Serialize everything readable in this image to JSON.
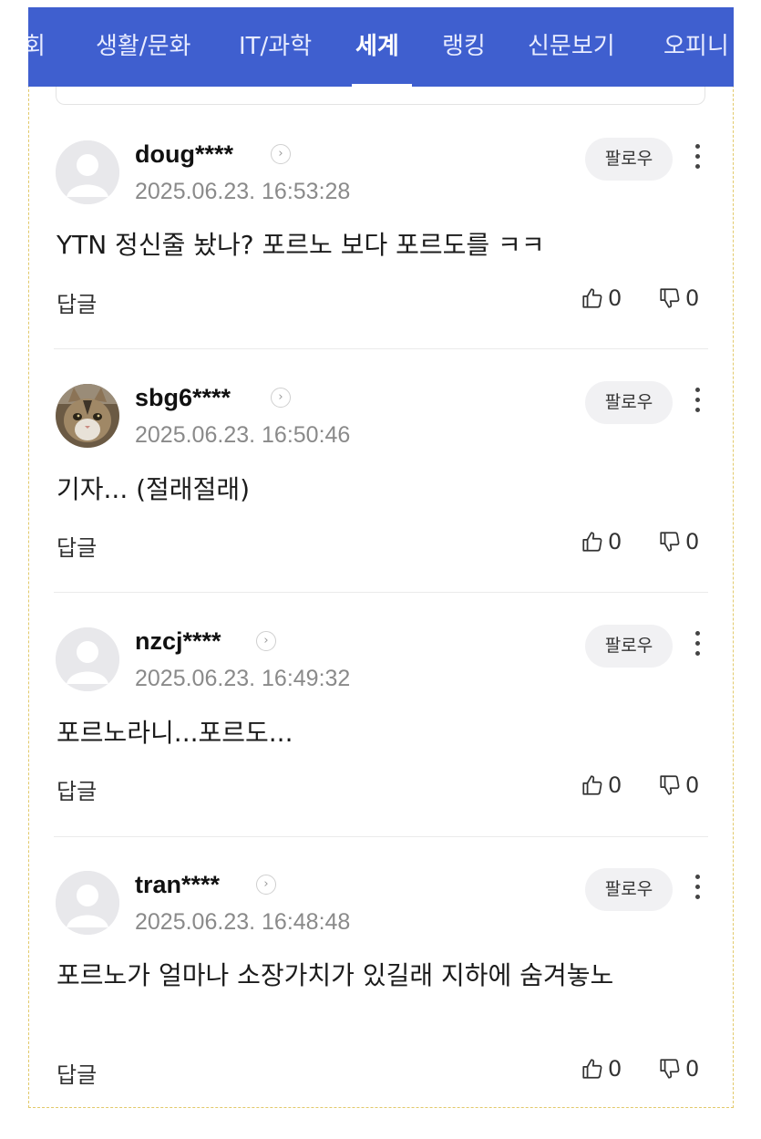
{
  "nav": {
    "items": [
      {
        "label": "회"
      },
      {
        "label": "생활/문화"
      },
      {
        "label": "IT/과학"
      },
      {
        "label": "세계"
      },
      {
        "label": "랭킹"
      },
      {
        "label": "신문보기"
      },
      {
        "label": "오피니"
      }
    ],
    "active_index": 3,
    "bg_color": "#3f5fcf"
  },
  "comments": [
    {
      "username": "doug****",
      "timestamp": "2025.06.23. 16:53:28",
      "text": "YTN 정신줄 놨나? 포르노 보다 포르도를 ㅋㅋ",
      "follow_label": "팔로우",
      "reply_label": "답글",
      "likes": "0",
      "dislikes": "0",
      "avatar": "default-avatar-icon"
    },
    {
      "username": "sbg6****",
      "timestamp": "2025.06.23. 16:50:46",
      "text": "기자... (절래절래)",
      "follow_label": "팔로우",
      "reply_label": "답글",
      "likes": "0",
      "dislikes": "0",
      "avatar": "cat-photo-avatar"
    },
    {
      "username": "nzcj****",
      "timestamp": "2025.06.23. 16:49:32",
      "text": "포르노라니...포르도...",
      "follow_label": "팔로우",
      "reply_label": "답글",
      "likes": "0",
      "dislikes": "0",
      "avatar": "default-avatar-icon"
    },
    {
      "username": "tran****",
      "timestamp": "2025.06.23. 16:48:48",
      "text": "포르노가 얼마나 소장가치가 있길래 지하에 숨겨놓노",
      "follow_label": "팔로우",
      "reply_label": "답글",
      "likes": "0",
      "dislikes": "0",
      "avatar": "default-avatar-icon"
    }
  ]
}
